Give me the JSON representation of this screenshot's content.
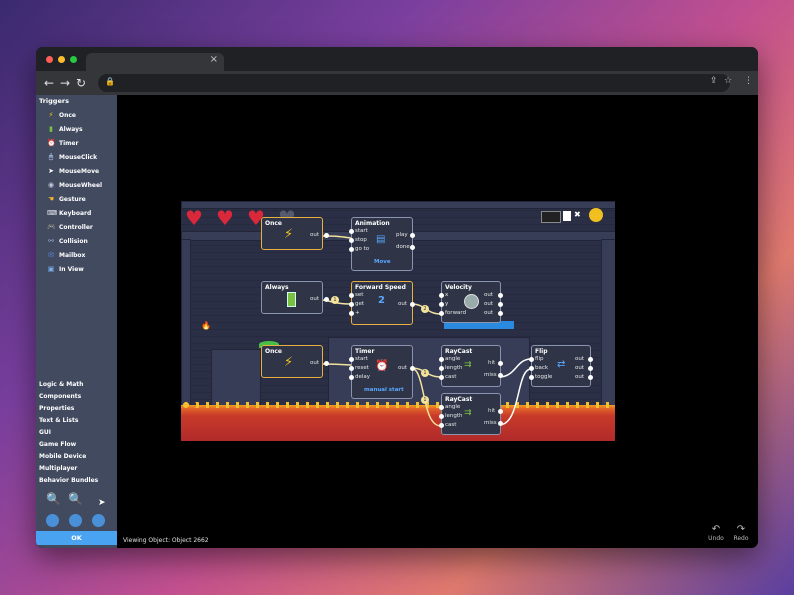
{
  "browser": {
    "tab_close": "×",
    "back": "←",
    "forward": "→",
    "reload": "↻",
    "lock": "🔒",
    "share": "⇪",
    "star": "☆",
    "menu": "⋮"
  },
  "sidebar": {
    "triggers_header": "Triggers",
    "triggers": [
      {
        "label": "Once",
        "icon": "lightning-icon",
        "color": "#f0c020",
        "glyph": "⚡"
      },
      {
        "label": "Always",
        "icon": "battery-icon",
        "color": "#7ac043",
        "glyph": "▮"
      },
      {
        "label": "Timer",
        "icon": "alarm-clock-icon",
        "color": "#d86a8a",
        "glyph": "⏰"
      },
      {
        "label": "MouseClick",
        "icon": "mouse-click-icon",
        "color": "#9aa8c8",
        "glyph": "🖱"
      },
      {
        "label": "MouseMove",
        "icon": "mouse-pointer-icon",
        "color": "#ffffff",
        "glyph": "➤"
      },
      {
        "label": "MouseWheel",
        "icon": "mouse-wheel-icon",
        "color": "#c0c8d8",
        "glyph": "◉"
      },
      {
        "label": "Gesture",
        "icon": "hand-gesture-icon",
        "color": "#f0b030",
        "glyph": "☚"
      },
      {
        "label": "Keyboard",
        "icon": "keyboard-icon",
        "color": "#e0e4ee",
        "glyph": "⌨"
      },
      {
        "label": "Controller",
        "icon": "gamepad-icon",
        "color": "#c0c8d8",
        "glyph": "🎮"
      },
      {
        "label": "Collision",
        "icon": "collision-icon",
        "color": "#9ab0d0",
        "glyph": "⚯"
      },
      {
        "label": "Mailbox",
        "icon": "mailbox-icon",
        "color": "#5a8ae0",
        "glyph": "✉"
      },
      {
        "label": "In View",
        "icon": "monitor-icon",
        "color": "#7ab0f0",
        "glyph": "▣"
      }
    ],
    "categories": [
      "Logic & Math",
      "Components",
      "Properties",
      "Text & Lists",
      "GUI",
      "Game Flow",
      "Mobile Device",
      "Multiplayer",
      "Behavior Bundles"
    ],
    "ok_label": "OK"
  },
  "status": {
    "viewing": "Viewing Object: Object 2662",
    "undo": "Undo",
    "redo": "Redo"
  },
  "nodes": {
    "once1": {
      "title": "Once",
      "out": "out"
    },
    "animation": {
      "title": "Animation",
      "in": [
        "start",
        "stop",
        "go to"
      ],
      "out": [
        "play",
        "done"
      ],
      "link": "Move"
    },
    "always": {
      "title": "Always",
      "out": "out"
    },
    "forward_speed": {
      "title": "Forward Speed",
      "in": [
        "set",
        "get",
        "+"
      ],
      "out": "out",
      "value": "2"
    },
    "velocity": {
      "title": "Velocity",
      "pins": [
        "x",
        "y",
        "forward"
      ],
      "out": [
        "out",
        "out",
        "out"
      ]
    },
    "once2": {
      "title": "Once",
      "out": "out"
    },
    "timer": {
      "title": "Timer",
      "in": [
        "start",
        "reset",
        "delay"
      ],
      "out": "out",
      "link": "manual start"
    },
    "raycast1": {
      "title": "RayCast",
      "in": [
        "angle",
        "length",
        "cast"
      ],
      "out": [
        "hit",
        "miss"
      ]
    },
    "flip": {
      "title": "Flip",
      "in": [
        "flip",
        "back",
        "toggle"
      ],
      "out": [
        "out",
        "out",
        "out"
      ]
    },
    "raycast2": {
      "title": "RayCast",
      "in": [
        "angle",
        "length",
        "cast"
      ],
      "out": [
        "hit",
        "miss"
      ]
    }
  },
  "badges": [
    "1",
    "2",
    "1",
    "1"
  ]
}
